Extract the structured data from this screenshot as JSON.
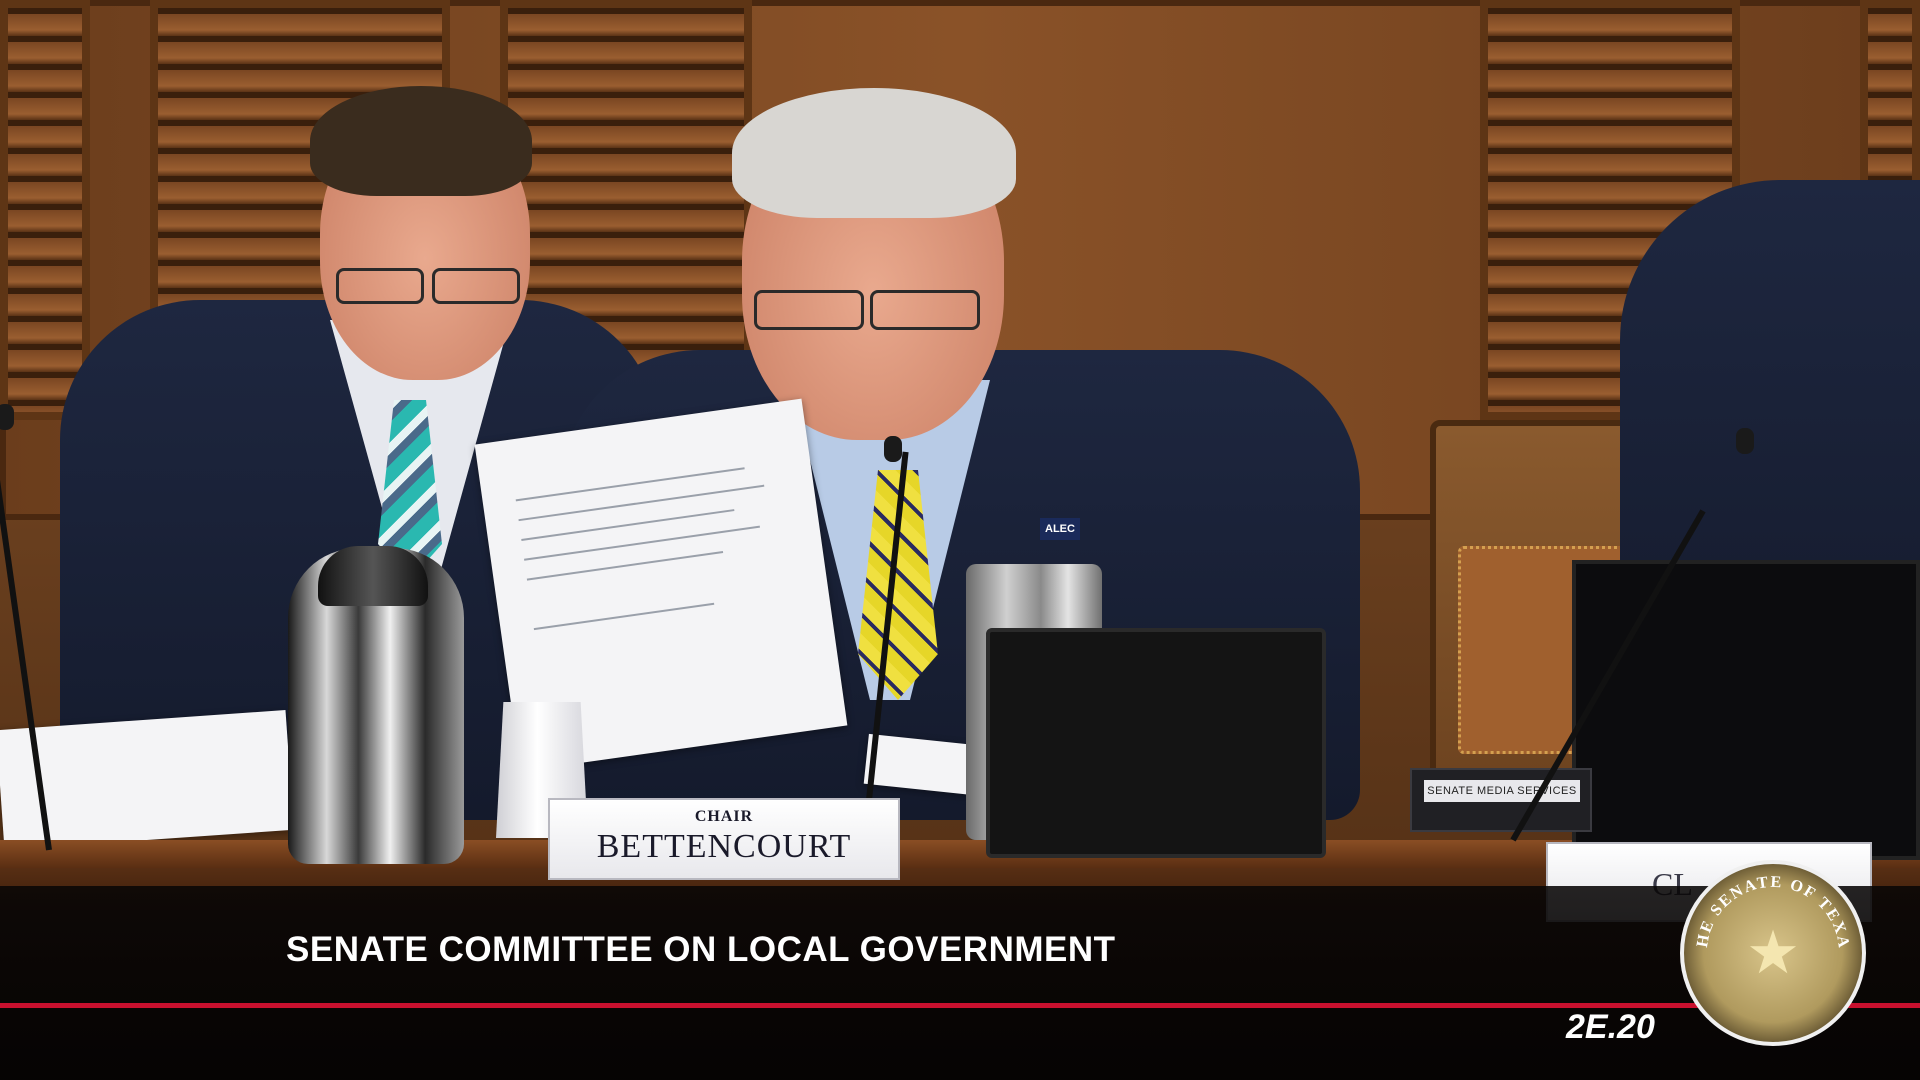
{
  "broadcast": {
    "caption": "SENATE COMMITTEE ON LOCAL GOVERNMENT",
    "room_code": "2E.20",
    "seal_text": "THE SENATE OF TEXAS"
  },
  "nameplates": {
    "chair_title": "CHAIR",
    "chair_name": "BETTENCOURT",
    "right_partial": "CL"
  },
  "props": {
    "media_label": "SENATE MEDIA SERVICES",
    "lapel_pin": "ALEC"
  },
  "colors": {
    "accent_red": "#c8102e",
    "caption_text": "#ffffff"
  }
}
